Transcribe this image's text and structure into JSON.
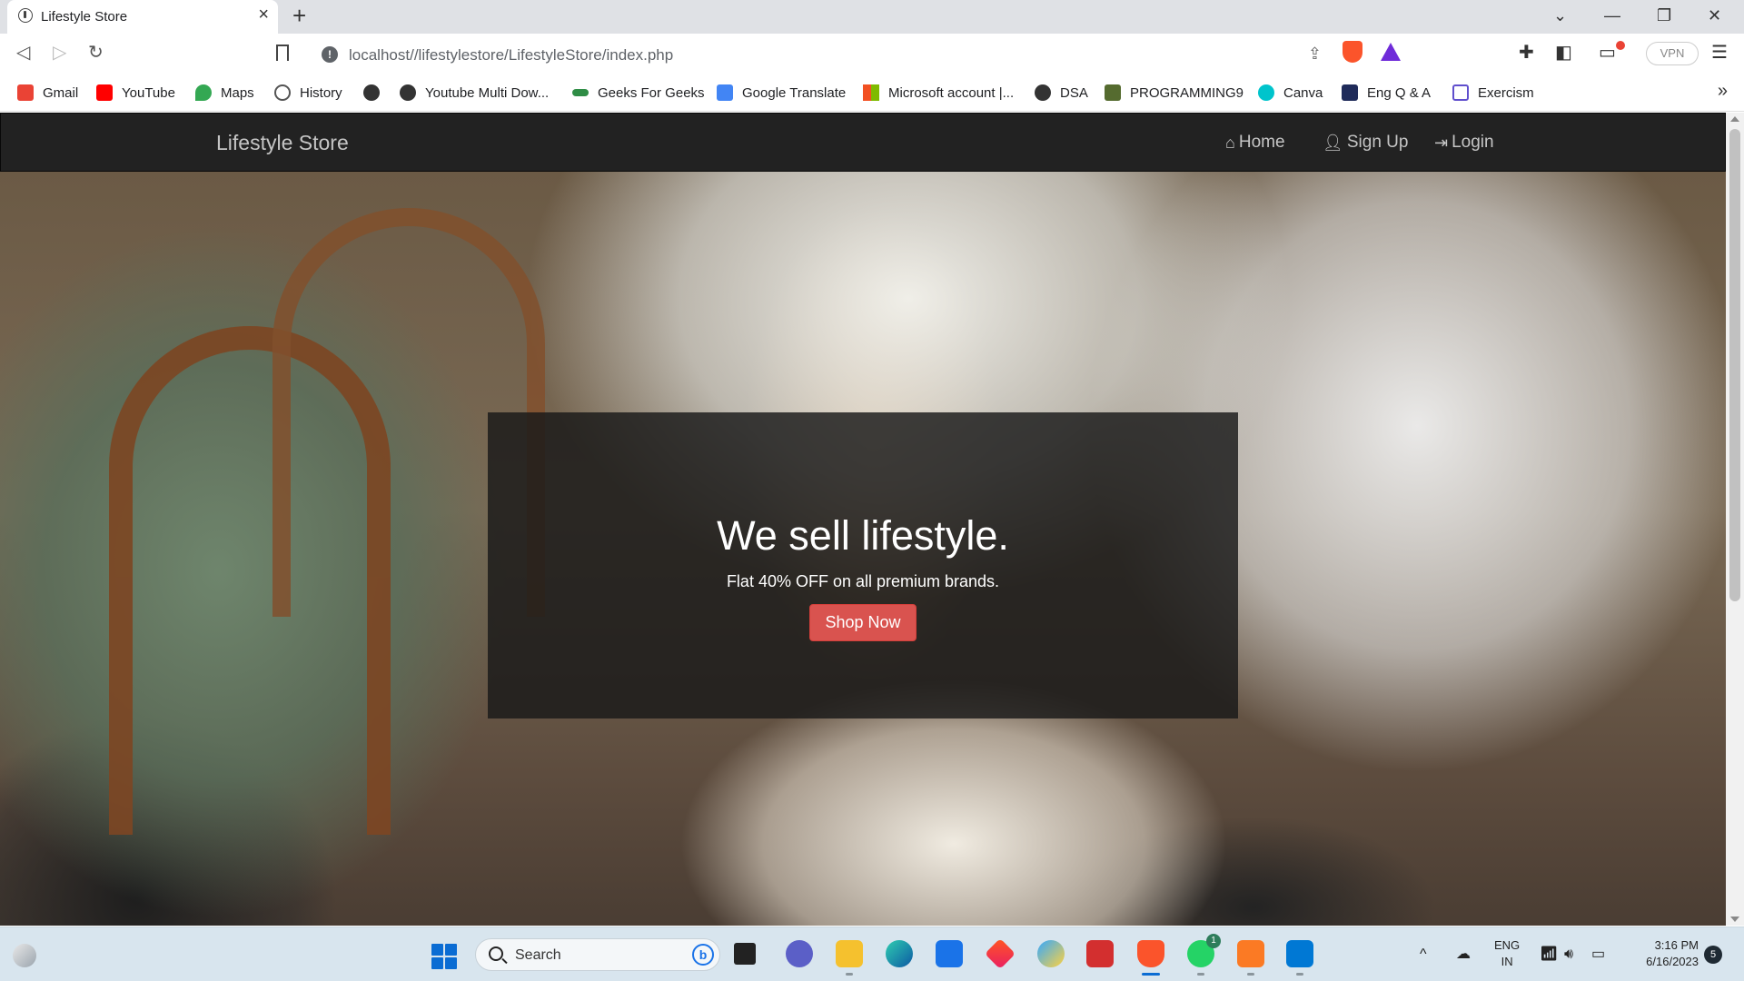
{
  "browser": {
    "tab_title": "Lifestyle Store",
    "url": "localhost//lifestylestore/LifestyleStore/index.php",
    "vpn_label": "VPN",
    "bookmarks": [
      {
        "label": "Gmail",
        "color": "#ea4335"
      },
      {
        "label": "YouTube",
        "color": "#ff0000"
      },
      {
        "label": "Maps",
        "color": "#34a853"
      },
      {
        "label": "History",
        "color": "#555555"
      },
      {
        "label": "",
        "color": "#333333"
      },
      {
        "label": "Youtube Multi Dow...",
        "color": "#333333"
      },
      {
        "label": "Geeks For Geeks",
        "color": "#2f8d46"
      },
      {
        "label": "Google Translate",
        "color": "#4285f4"
      },
      {
        "label": "Microsoft account |...",
        "color": "#f25022"
      },
      {
        "label": "DSA",
        "color": "#333333"
      },
      {
        "label": "PROGRAMMING9",
        "color": "#556b2f"
      },
      {
        "label": "Canva",
        "color": "#00c4cc"
      },
      {
        "label": "Eng Q & A",
        "color": "#1f2b5a"
      },
      {
        "label": "Exercism",
        "color": "#604fcd"
      }
    ]
  },
  "site": {
    "brand": "Lifestyle Store",
    "nav": {
      "home": "Home",
      "signup": "Sign Up",
      "login": "Login"
    },
    "hero": {
      "headline": "We sell lifestyle.",
      "subtext": "Flat 40% OFF on all premium brands.",
      "cta": "Shop Now",
      "cta_color": "#d9534f"
    }
  },
  "taskbar": {
    "search_label": "Search",
    "whatsapp_badge": "1",
    "lang_line1": "ENG",
    "lang_line2": "IN",
    "time": "3:16 PM",
    "date": "6/16/2023",
    "notification_count": "5"
  }
}
